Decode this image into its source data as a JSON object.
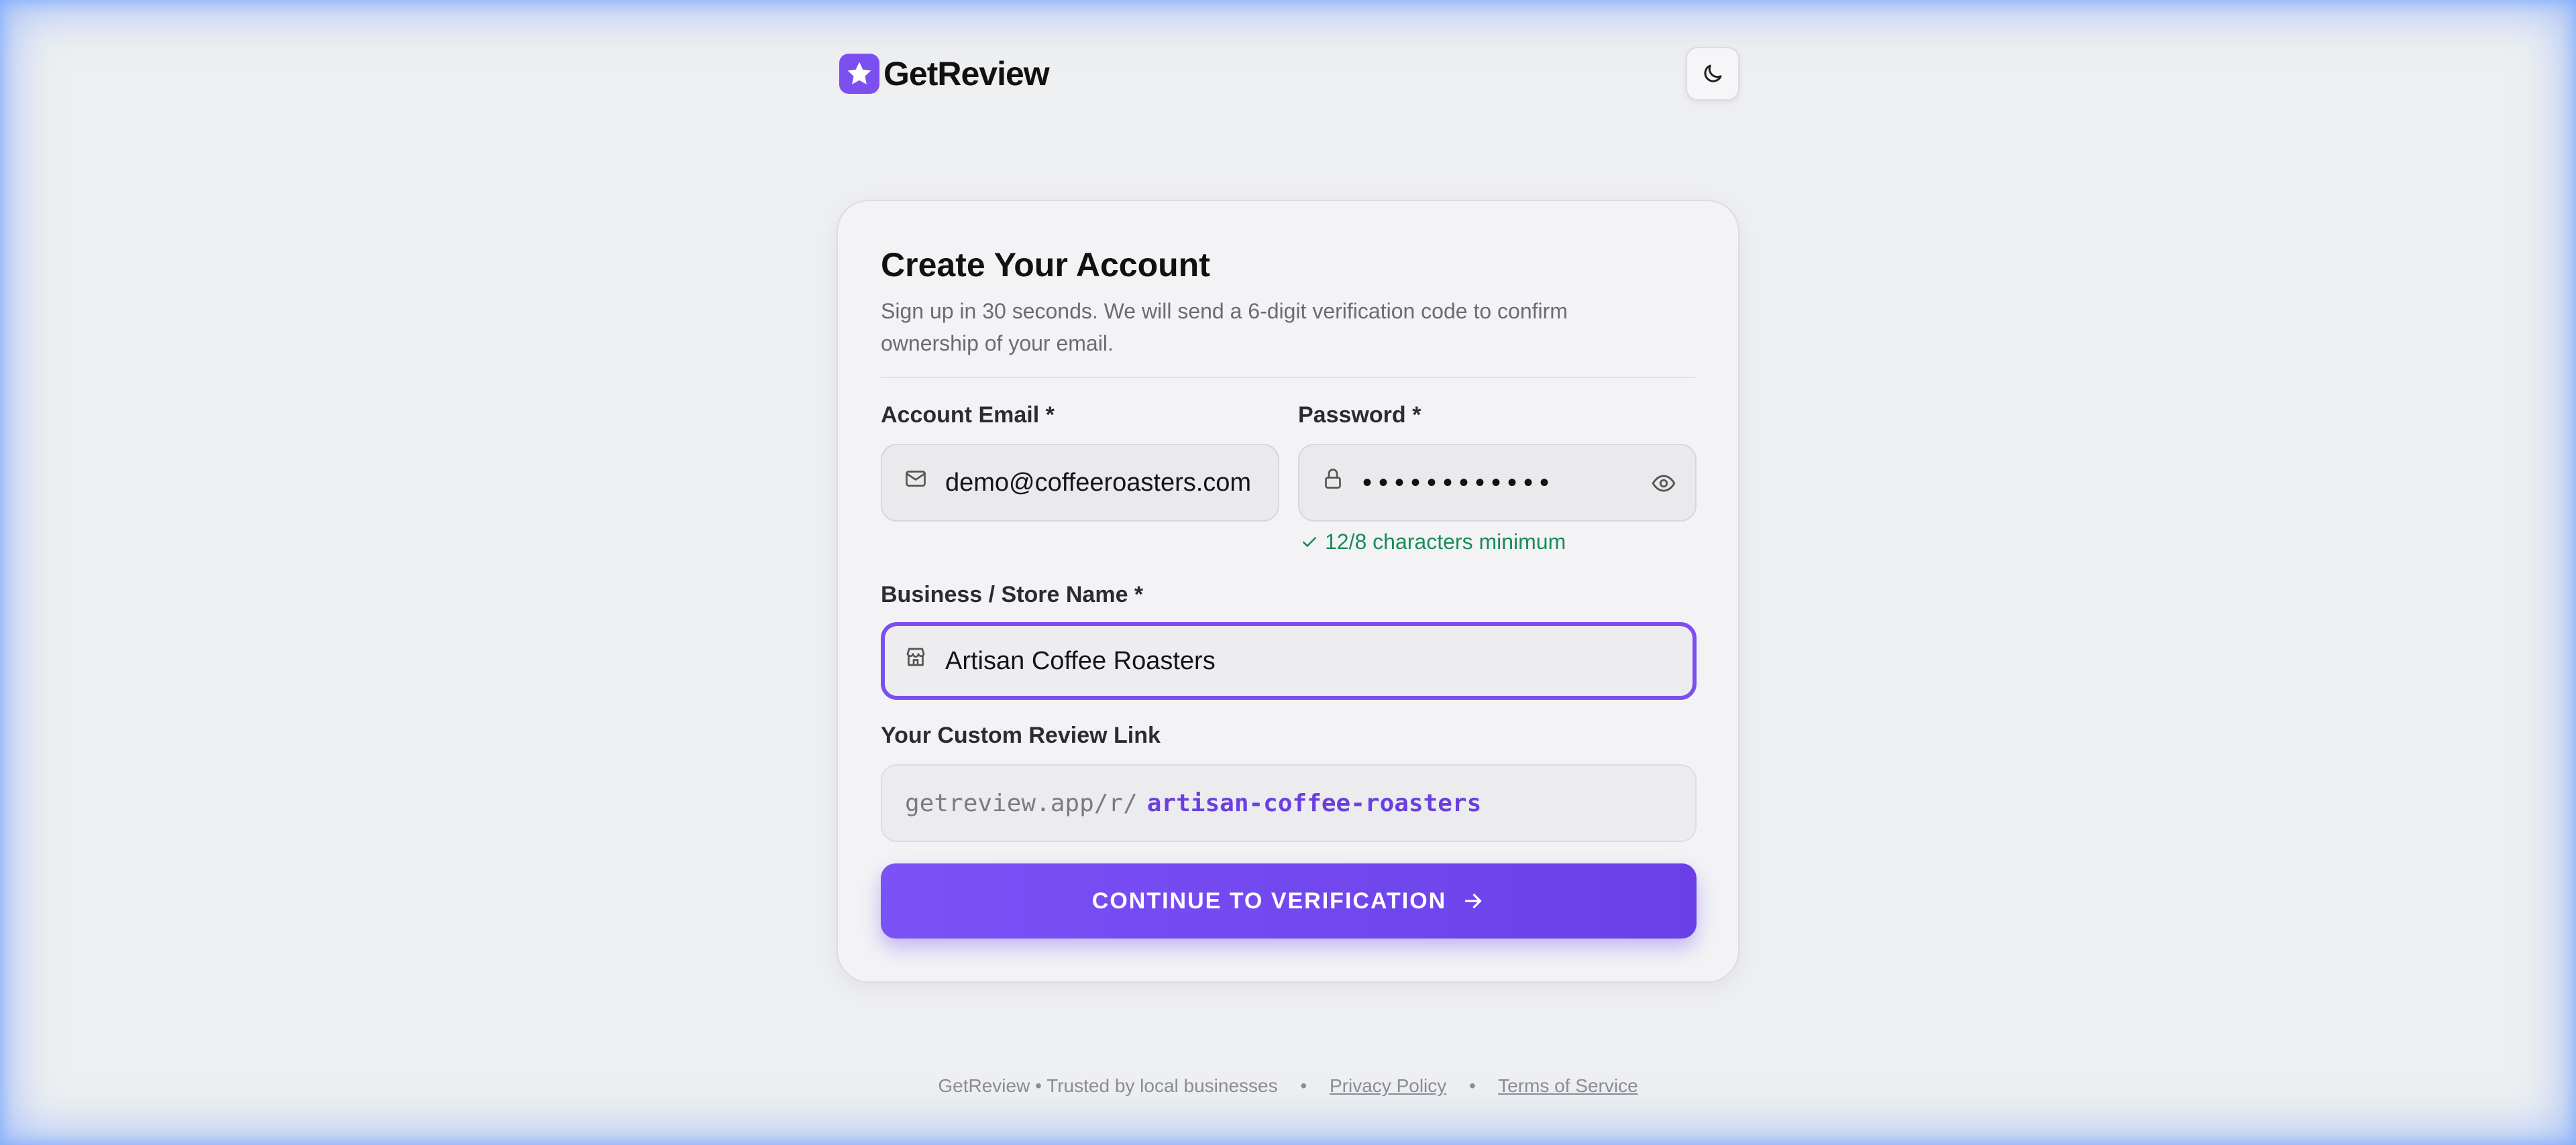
{
  "brand": {
    "name": "GetReview",
    "logo_icon": "star-icon",
    "accent": "#7c4ff0"
  },
  "header": {
    "theme_toggle_icon": "moon-icon"
  },
  "card": {
    "title": "Create Your Account",
    "subtitle": "Sign up in 30 seconds. We will send a 6-digit verification code to confirm ownership of your email."
  },
  "form": {
    "email": {
      "label": "Account Email *",
      "value": "demo@coffeeroasters.com",
      "icon": "mail-icon"
    },
    "password": {
      "label": "Password *",
      "masked_value": "••••••••••••",
      "icon": "lock-icon",
      "toggle_icon": "eye-icon",
      "hint": "12/8 characters minimum",
      "hint_color": "#1a8a5a"
    },
    "business": {
      "label": "Business / Store Name *",
      "value": "Artisan Coffee Roasters",
      "icon": "store-icon"
    },
    "review_link": {
      "label": "Your Custom Review Link",
      "prefix": "getreview.app/r/",
      "slug": "artisan-coffee-roasters"
    }
  },
  "cta": {
    "label": "CONTINUE TO VERIFICATION",
    "icon": "arrow-right-icon"
  },
  "footer": {
    "text": "GetReview • Trusted by local businesses",
    "separator": "•",
    "privacy": "Privacy Policy",
    "terms": "Terms of Service"
  }
}
